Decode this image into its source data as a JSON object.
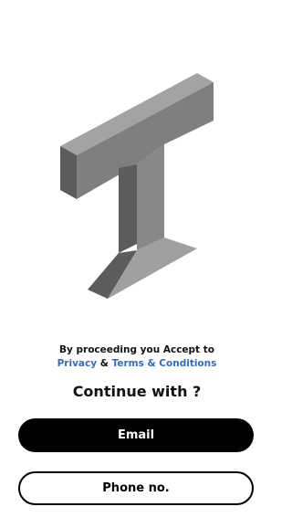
{
  "logo": {
    "icon": "3d-letter-t-logo",
    "colors": {
      "top": "#a3a3a3",
      "front": "#7f7f7f",
      "side": "#5c5c5c"
    }
  },
  "consent": {
    "prefix": "By proceeding you Accept to",
    "privacy_link": "Privacy",
    "and": "&",
    "terms_link": "Terms & Conditions",
    "link_color": "#2d6ec8"
  },
  "continue_heading": "Continue with ?",
  "buttons": {
    "email_label": "Email",
    "phone_label": "Phone no."
  }
}
